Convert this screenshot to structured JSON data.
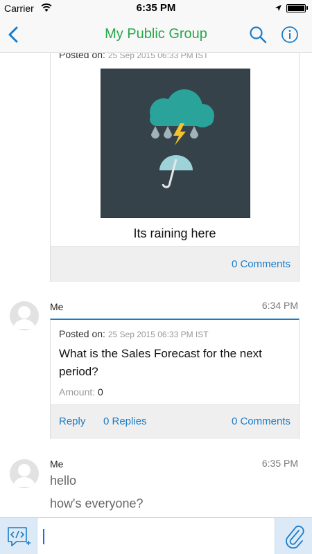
{
  "status_bar": {
    "carrier": "Carrier",
    "time": "6:35 PM",
    "battery_level": 1.0
  },
  "nav": {
    "title": "My Public Group",
    "icons": [
      "back-chevron-icon",
      "search-icon",
      "info-icon"
    ]
  },
  "colors": {
    "title_green": "#27a84a",
    "link_blue": "#1a7cc6",
    "divider_blue": "#1a7cc6"
  },
  "feed": {
    "post1": {
      "posted_on_label": "Posted on:",
      "date": "25 Sep 2015 06:33 PM IST",
      "image_icons": [
        "storm-cloud-icon",
        "umbrella-icon"
      ],
      "caption": "Its raining here",
      "comments": "0 Comments"
    },
    "post2": {
      "author": "Me",
      "time": "6:34 PM",
      "posted_on_label": "Posted on:",
      "date": "25 Sep 2015 06:33 PM IST",
      "question": "What is the Sales Forecast for the next period?",
      "amount_label": "Amount:",
      "amount_value": "0",
      "reply": "Reply",
      "replies": "0 Replies",
      "comments": "0 Comments"
    },
    "post3": {
      "author": "Me",
      "time": "6:35 PM",
      "messages": [
        "hello",
        "how's everyone?"
      ]
    }
  },
  "composer": {
    "input_value": "",
    "icons": [
      "code-snippet-icon",
      "paperclip-icon"
    ]
  }
}
